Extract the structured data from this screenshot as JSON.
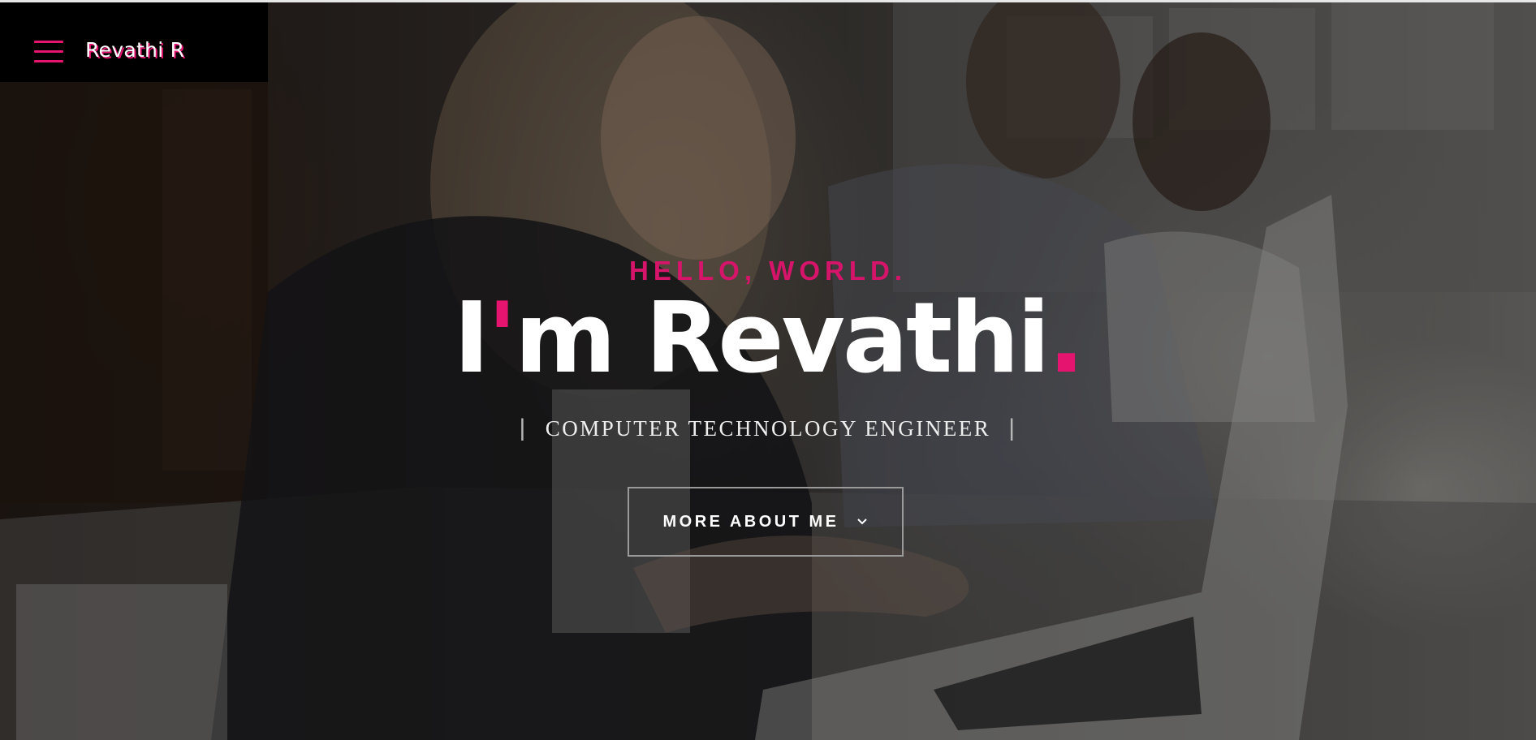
{
  "header": {
    "brand": "Revathi R",
    "menu_icon": "hamburger-menu-icon"
  },
  "hero": {
    "kicker": "HELLO, WORLD.",
    "headline": {
      "prefix": "I",
      "apostrophe": "'",
      "name": "m Revathi",
      "dot": "."
    },
    "subtitle": {
      "bar_left": "|",
      "text": "COMPUTER TECHNOLOGY ENGINEER",
      "bar_right": "|"
    },
    "cta": {
      "label": "MORE ABOUT ME",
      "icon": "chevron-down-icon"
    }
  },
  "colors": {
    "accent": "#e5146f",
    "brand_box": "#000000",
    "text": "#ffffff"
  }
}
